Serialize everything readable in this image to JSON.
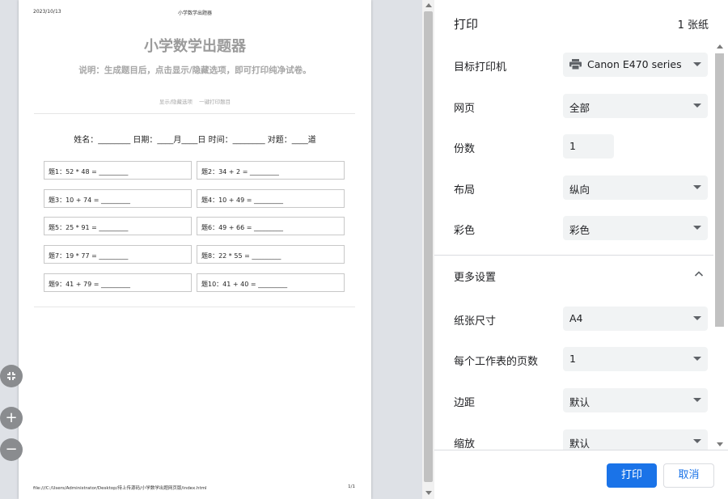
{
  "preview": {
    "header_date": "2023/10/13",
    "header_title": "小学数学出题器",
    "doc_title": "小学数学出题器",
    "doc_subtitle": "说明：生成题目后，点击显示/隐藏选项，即可打印纯净试卷。",
    "link_toggle": "显示/隐藏选项",
    "link_print": "一键打印题目",
    "student_line": "姓名：________ 日期：____月____日 时间：________ 对题：____道",
    "questions": [
      "题1：52 * 48 = _________",
      "题2：34 + 2 = _________",
      "题3：10 + 74 = _________",
      "题4：10 + 49 = _________",
      "题5：25 * 91 = _________",
      "题6：49 + 66 = _________",
      "题7：19 * 77 = _________",
      "题8：22 * 55 = _________",
      "题9：41 + 79 = _________",
      "题10：41 + 40 = _________"
    ],
    "footer_path": "file:///C:/Users/Administrator/Desktop/待上传源码/小学数学出题网页版/index.html",
    "footer_page": "1/1",
    "zoom_fit_icon": "fit-to-page-icon",
    "zoom_in_label": "+",
    "zoom_out_label": "−"
  },
  "panel": {
    "title": "打印",
    "sheet_count": "1 张纸",
    "destination_label": "目标打印机",
    "destination_value": "Canon E470 series",
    "pages_label": "网页",
    "pages_value": "全部",
    "copies_label": "份数",
    "copies_value": "1",
    "layout_label": "布局",
    "layout_value": "纵向",
    "color_label": "彩色",
    "color_value": "彩色",
    "more_settings_label": "更多设置",
    "paper_size_label": "纸张尺寸",
    "paper_size_value": "A4",
    "pages_per_sheet_label": "每个工作表的页数",
    "pages_per_sheet_value": "1",
    "margins_label": "边距",
    "margins_value": "默认",
    "scale_label": "缩放",
    "scale_value": "默认",
    "print_button": "打印",
    "cancel_button": "取消"
  },
  "colors": {
    "accent": "#1a73e8",
    "field_bg": "#f1f3f4",
    "preview_bg": "#dee1e6"
  }
}
